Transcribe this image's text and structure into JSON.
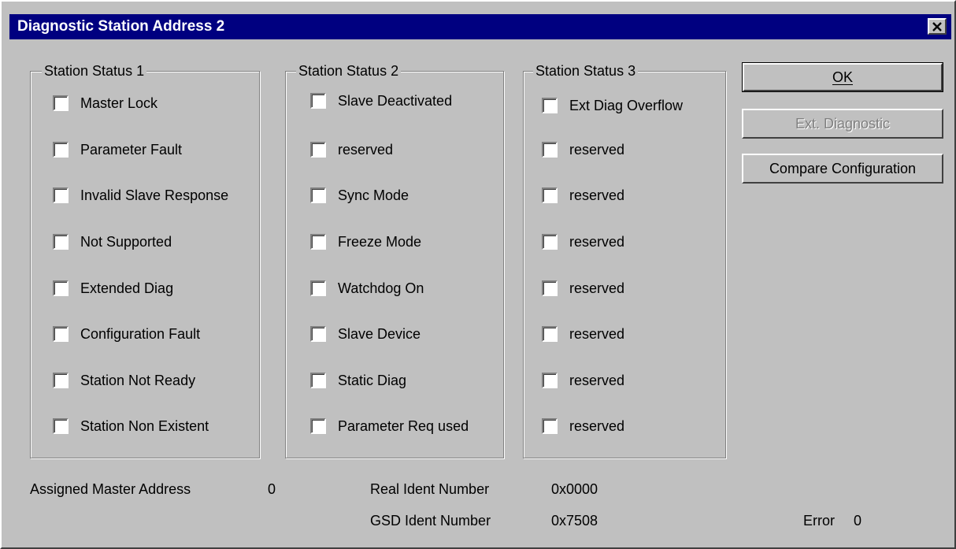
{
  "window": {
    "title": "Diagnostic Station Address 2"
  },
  "groups": [
    {
      "legend": "Station Status 1",
      "items": [
        "Master Lock",
        "Parameter Fault",
        "Invalid Slave Response",
        "Not Supported",
        "Extended Diag",
        "Configuration Fault",
        "Station Not Ready",
        "Station Non Existent"
      ]
    },
    {
      "legend": "Station Status 2",
      "items": [
        "Slave Deactivated",
        "reserved",
        "Sync Mode",
        "Freeze Mode",
        "Watchdog On",
        "Slave Device",
        "Static Diag",
        "Parameter Req used"
      ]
    },
    {
      "legend": "Station Status 3",
      "items": [
        "Ext Diag Overflow",
        "reserved",
        "reserved",
        "reserved",
        "reserved",
        "reserved",
        "reserved",
        "reserved"
      ]
    }
  ],
  "buttons": {
    "ok": "OK",
    "ext_diagnostic": "Ext. Diagnostic",
    "compare_configuration": "Compare Configuration"
  },
  "info": {
    "assigned_master_label": "Assigned Master Address",
    "assigned_master_value": "0",
    "real_ident_label": "Real Ident Number",
    "real_ident_value": "0x0000",
    "gsd_ident_label": "GSD Ident Number",
    "gsd_ident_value": "0x7508",
    "error_label": "Error",
    "error_value": "0"
  }
}
